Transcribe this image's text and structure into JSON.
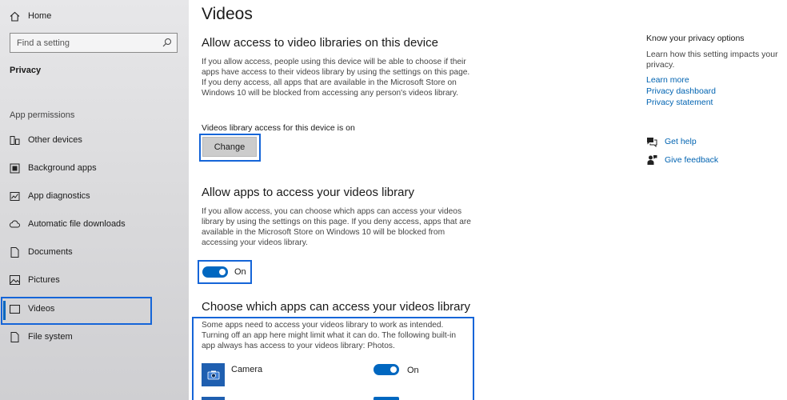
{
  "sidebar": {
    "home_label": "Home",
    "search_placeholder": "Find a setting",
    "category": "Privacy",
    "section": "App permissions",
    "items": [
      {
        "label": "Other devices",
        "icon": "devices-icon"
      },
      {
        "label": "Background apps",
        "icon": "background-apps-icon"
      },
      {
        "label": "App diagnostics",
        "icon": "diagnostics-icon"
      },
      {
        "label": "Automatic file downloads",
        "icon": "cloud-icon"
      },
      {
        "label": "Documents",
        "icon": "document-icon"
      },
      {
        "label": "Pictures",
        "icon": "picture-icon"
      },
      {
        "label": "Videos",
        "icon": "video-icon"
      },
      {
        "label": "File system",
        "icon": "file-icon"
      }
    ],
    "selected": "Videos"
  },
  "main": {
    "title": "Videos",
    "section1": {
      "heading": "Allow access to video libraries on this device",
      "description": "If you allow access, people using this device will be able to choose if their apps have access to their videos library by using the settings on this page. If you deny access, all apps that are available in the Microsoft Store on Windows 10 will be blocked from accessing any person's videos library.",
      "status": "Videos library access for this device is on",
      "button_label": "Change"
    },
    "section2": {
      "heading": "Allow apps to access your videos library",
      "description": "If you allow access, you can choose which apps can access your videos library by using the settings on this page. If you deny access, apps that are available in the Microsoft Store on Windows 10 will be blocked from accessing your videos library.",
      "toggle_label": "On"
    },
    "section3": {
      "heading": "Choose which apps can access your videos library",
      "description": "Some apps need to access your videos library to work as intended. Turning off an app here might limit what it can do. The following built-in app always has access to your videos library: Photos.",
      "apps": [
        {
          "name": "Camera",
          "toggle_label": "On"
        }
      ]
    }
  },
  "right": {
    "heading": "Know your privacy options",
    "description": "Learn how this setting impacts your privacy.",
    "links": [
      "Learn more",
      "Privacy dashboard",
      "Privacy statement"
    ],
    "help": "Get help",
    "feedback": "Give feedback"
  },
  "colors": {
    "accent": "#0067c0",
    "link": "#0063b1",
    "highlight": "#1565d8"
  }
}
